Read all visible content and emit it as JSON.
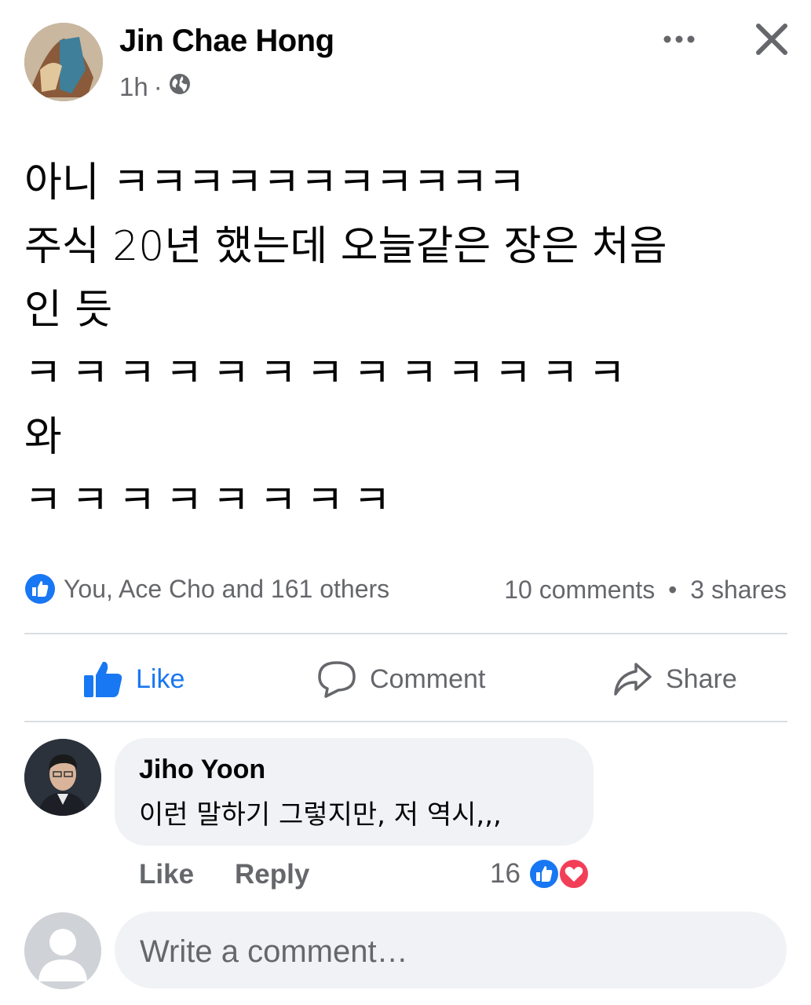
{
  "post": {
    "author": "Jin Chae Hong",
    "time": "1h",
    "separator": "·",
    "audience_icon": "globe-icon",
    "lines": [
      "아니 ㅋㅋㅋㅋㅋㅋㅋㅋㅋㅋㅋ",
      "주식 20년 했는데 오늘같은 장은 처음",
      "인 듯",
      "ㅋㅋㅋㅋㅋㅋㅋㅋㅋㅋㅋㅋㅋ",
      "와",
      "ㅋㅋㅋㅋㅋㅋㅋㅋ"
    ]
  },
  "stats": {
    "reactions_text": "You, Ace Cho and 161 others",
    "comments": "10 comments",
    "dot": "•",
    "shares": "3 shares"
  },
  "actions": {
    "like": "Like",
    "comment": "Comment",
    "share": "Share"
  },
  "comment": {
    "author": "Jiho Yoon",
    "text": "이런 말하기 그렇지만, 저 역시,,,",
    "like": "Like",
    "reply": "Reply",
    "reaction_count": "16"
  },
  "composer": {
    "placeholder": "Write a comment…"
  },
  "colors": {
    "brand_blue": "#1877f2",
    "secondary_text": "#65676b",
    "bubble_bg": "#f0f2f5",
    "love_red": "#f33e58"
  }
}
